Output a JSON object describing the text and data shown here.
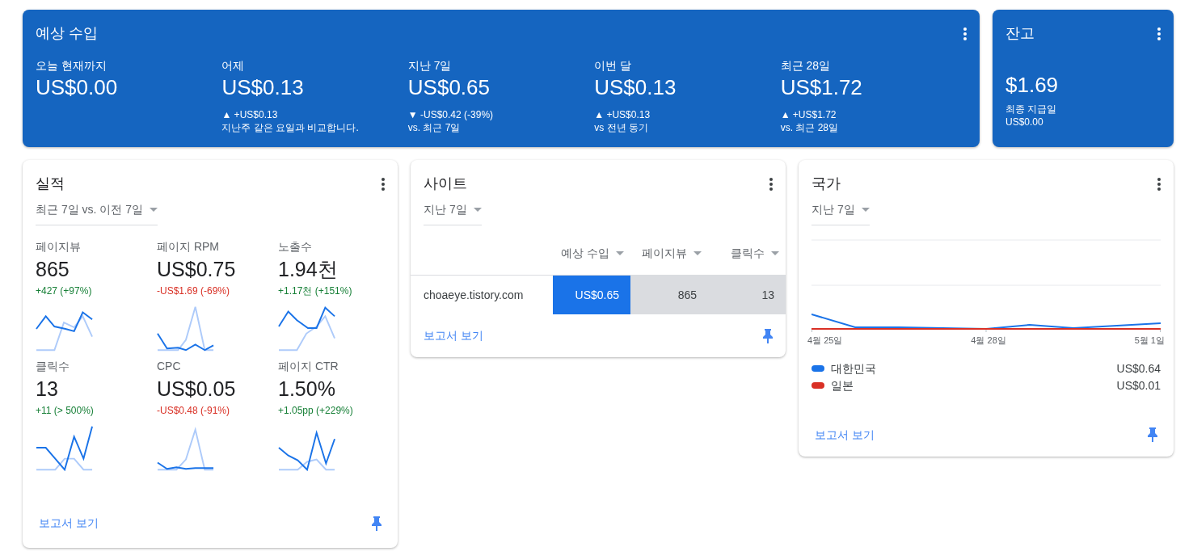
{
  "earnings": {
    "title": "예상 수입",
    "periods": [
      {
        "label": "오늘 현재까지",
        "value": "US$0.00"
      },
      {
        "label": "어제",
        "value": "US$0.13",
        "change": "▲ +US$0.13",
        "note": "지난주 같은 요일과 비교합니다."
      },
      {
        "label": "지난 7일",
        "value": "US$0.65",
        "change": "▼ -US$0.42 (-39%)",
        "note": "vs. 최근 7일"
      },
      {
        "label": "이번 달",
        "value": "US$0.13",
        "change": "▲ +US$0.13",
        "note": "vs 전년 동기"
      },
      {
        "label": "최근 28일",
        "value": "US$1.72",
        "change": "▲ +US$1.72",
        "note": "vs. 최근 28일"
      }
    ]
  },
  "balance": {
    "title": "잔고",
    "value": "$1.69",
    "label": "최종 지급일",
    "amount": "US$0.00"
  },
  "performance": {
    "title": "실적",
    "range": "최근 7일 vs. 이전 7일",
    "metrics": [
      {
        "label": "페이지뷰",
        "value": "865",
        "change": "+427 (+97%)",
        "color": "#188038"
      },
      {
        "label": "페이지 RPM",
        "value": "US$0.75",
        "change": "-US$1.69 (-69%)",
        "color": "#d93025"
      },
      {
        "label": "노출수",
        "value": "1.94천",
        "change": "+1.17천 (+151%)",
        "color": "#188038"
      },
      {
        "label": "클릭수",
        "value": "13",
        "change": "+11 (> 500%)",
        "color": "#188038"
      },
      {
        "label": "CPC",
        "value": "US$0.05",
        "change": "-US$0.48 (-91%)",
        "color": "#d93025"
      },
      {
        "label": "페이지 CTR",
        "value": "1.50%",
        "change": "+1.05pp (+229%)",
        "color": "#188038"
      }
    ],
    "link": "보고서 보기"
  },
  "sites": {
    "title": "사이트",
    "range": "지난 7일",
    "columns": [
      "예상 수입",
      "페이지뷰",
      "클릭수"
    ],
    "rows": [
      {
        "site": "choaeye.tistory.com",
        "cells": [
          "US$0.65",
          "865",
          "13"
        ]
      }
    ],
    "link": "보고서 보기"
  },
  "countries": {
    "title": "국가",
    "range": "지난 7일",
    "axis_labels": [
      "4월 25일",
      "4월 28일",
      "5월 1일"
    ],
    "legend": [
      {
        "name": "대한민국",
        "value": "US$0.64",
        "color": "#1a73e8"
      },
      {
        "name": "일본",
        "value": "US$0.01",
        "color": "#d93025"
      }
    ],
    "link": "보고서 보기"
  }
}
